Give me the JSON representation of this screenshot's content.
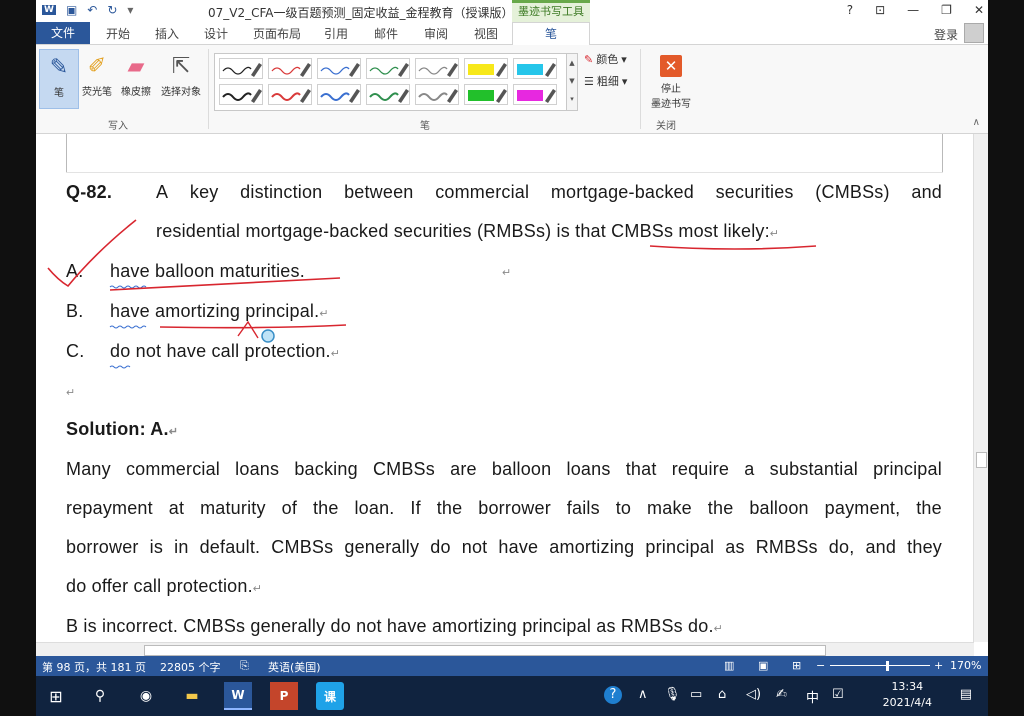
{
  "window": {
    "title": "07_V2_CFA一级百题预测_固定收益_金程教育（授课版）...",
    "context_tab_group": "墨迹书写工具",
    "help": "?",
    "restore_ribbon": "⊡",
    "minimize": "—",
    "maximize": "❐",
    "close": "✕"
  },
  "quick_access": {
    "save_icon": "save-icon",
    "undo": "↶",
    "redo": "↻",
    "more": "▾"
  },
  "tabs": [
    "文件",
    "开始",
    "插入",
    "设计",
    "页面布局",
    "引用",
    "邮件",
    "审阅",
    "视图",
    "笔"
  ],
  "account": {
    "login": "登录"
  },
  "ribbon": {
    "write_tools": [
      {
        "label": "笔",
        "icon": "pen-icon"
      },
      {
        "label": "荧光笔",
        "icon": "highlighter-icon"
      },
      {
        "label": "橡皮擦",
        "icon": "eraser-icon"
      },
      {
        "label": "选择对象",
        "icon": "select-arrow-icon"
      }
    ],
    "write_group": "写入",
    "pen_group": "笔",
    "color_label": "颜色",
    "weight_label": "粗细",
    "stop_label_1": "停止",
    "stop_label_2": "墨迹书写",
    "close_group": "关闭",
    "pen_colors": [
      "#222222",
      "#d93a3a",
      "#3a6fd0",
      "#2f8f4e",
      "#888888",
      "#f7e81a",
      "#26c6ea",
      "#222222",
      "#d93a3a",
      "#3a6fd0",
      "#2f8f4e",
      "#888888",
      "#22c02b",
      "#e728e0"
    ]
  },
  "document": {
    "q_label": "Q-82.",
    "q_line1": [
      "A",
      "key",
      "distinction",
      "between",
      "commercial",
      "mortgage-backed",
      "securities",
      "(CMBSs)",
      "and"
    ],
    "q_line2": "residential mortgage-backed securities (RMBSs) is that CMBSs most likely:",
    "options": [
      {
        "letter": "A.",
        "text": "have balloon maturities."
      },
      {
        "letter": "B.",
        "text": "have amortizing principal."
      },
      {
        "letter": "C.",
        "text": "do not have call protection."
      }
    ],
    "solution": "Solution: A.",
    "sol_line1": [
      "Many",
      "commercial",
      "loans",
      "backing",
      "CMBSs",
      "are",
      "balloon",
      "loans",
      "that",
      "require",
      "a",
      "substantial",
      "principal"
    ],
    "sol_line2": [
      "repayment",
      "at",
      "maturity",
      "of",
      "the",
      "loan.",
      "If",
      "the",
      "borrower",
      "fails",
      "to",
      "make",
      "the",
      "balloon",
      "payment,",
      "the"
    ],
    "sol_line3": [
      "borrower",
      "is",
      "in",
      "default.",
      "CMBSs",
      "generally",
      "do",
      "not",
      "have",
      "amortizing",
      "principal",
      "as",
      "RMBSs",
      "do,",
      "and",
      "they"
    ],
    "sol_line4": "do offer call protection.",
    "b_line": "B is incorrect. CMBSs generally do not have amortizing principal as RMBSs do.",
    "para_mark": "↵"
  },
  "statusbar": {
    "page": "第 98 页，共 181 页",
    "words": "22805 个字",
    "language": "英语(美国)",
    "zoom": "170%"
  },
  "taskbar": {
    "time": "13:34",
    "date": "2021/4/4",
    "ime": "中"
  },
  "colors": {
    "accent": "#2b579a",
    "ink": "#d8262f",
    "taskbar": "#10233f"
  }
}
